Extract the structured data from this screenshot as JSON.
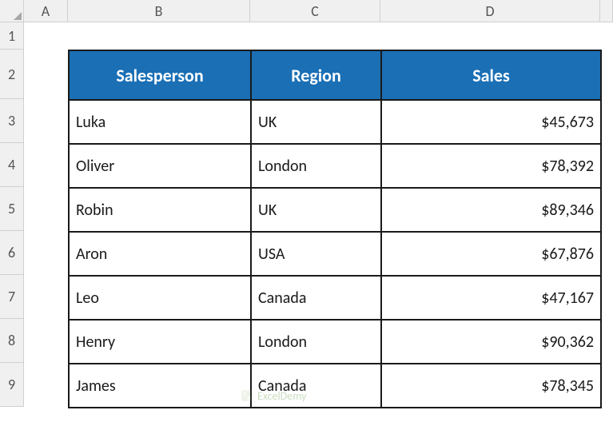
{
  "columns": {
    "A": "A",
    "B": "B",
    "C": "C",
    "D": "D"
  },
  "rows": [
    "1",
    "2",
    "3",
    "4",
    "5",
    "6",
    "7",
    "8",
    "9"
  ],
  "table": {
    "headers": {
      "salesperson": "Salesperson",
      "region": "Region",
      "sales": "Sales"
    },
    "rows": [
      {
        "salesperson": "Luka",
        "region": "UK",
        "sales": "$45,673"
      },
      {
        "salesperson": "Oliver",
        "region": "London",
        "sales": "$78,392"
      },
      {
        "salesperson": "Robin",
        "region": "UK",
        "sales": "$89,346"
      },
      {
        "salesperson": "Aron",
        "region": "USA",
        "sales": "$67,876"
      },
      {
        "salesperson": "Leo",
        "region": "Canada",
        "sales": "$47,167"
      },
      {
        "salesperson": "Henry",
        "region": "London",
        "sales": "$90,362"
      },
      {
        "salesperson": "James",
        "region": "Canada",
        "sales": "$78,345"
      }
    ]
  },
  "watermark": "ExcelDemy",
  "theme": {
    "header_bg": "#1e78c8",
    "header_fg": "#ffffff",
    "border": "#1a1a1a"
  }
}
